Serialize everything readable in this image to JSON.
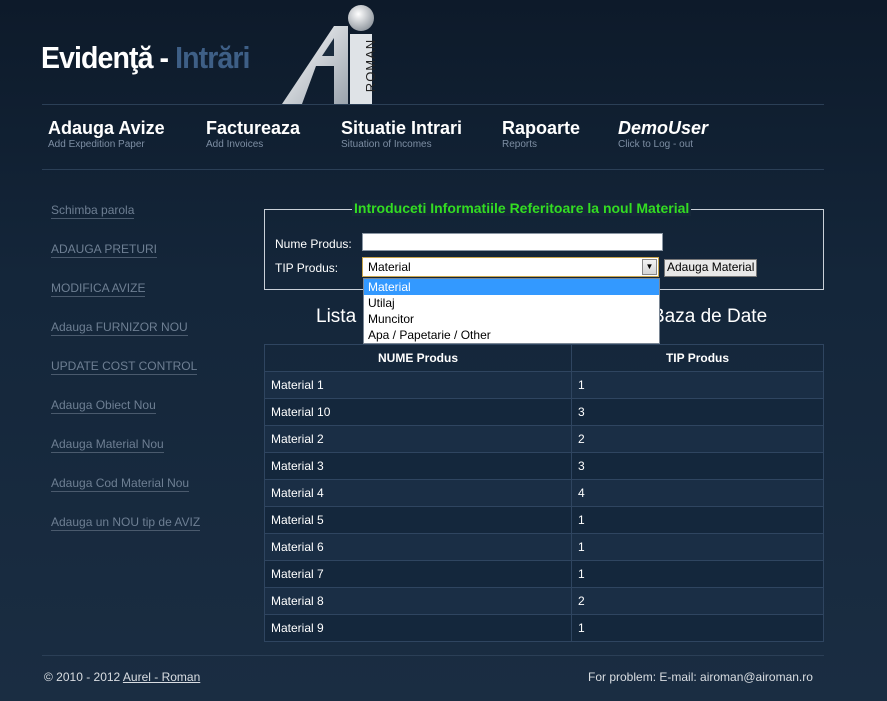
{
  "header": {
    "title_part1": "Evidenţă",
    "title_sep": " - ",
    "title_part2": "Intrări",
    "logo_text": "ROMAN"
  },
  "nav": [
    {
      "label": "Adauga Avize",
      "sub": "Add Expedition Paper"
    },
    {
      "label": "Factureaza",
      "sub": "Add Invoices"
    },
    {
      "label": "Situatie Intrari",
      "sub": "Situation of Incomes"
    },
    {
      "label": "Rapoarte",
      "sub": "Reports"
    },
    {
      "label": "DemoUser",
      "sub": "Click to Log - out"
    }
  ],
  "sidebar": [
    "Schimba parola",
    "ADAUGA PRETURI",
    "MODIFICA AVIZE",
    "Adauga FURNIZOR NOU",
    "UPDATE COST CONTROL",
    "Adauga Obiect Nou",
    "Adauga Material Nou",
    "Adauga Cod Material Nou",
    "Adauga un NOU tip de AVIZ"
  ],
  "form": {
    "legend": "Introduceti Informatiile Referitoare la noul Material",
    "name_label": "Nume Produs:",
    "name_value": "",
    "type_label": "TIP Produs:",
    "type_value": "Material",
    "submit_label": "Adauga Material",
    "options": [
      "Material",
      "Utilaj",
      "Muncitor",
      "Apa / Papetarie / Other"
    ]
  },
  "list": {
    "title_left": "Lista",
    "title_right": "Baza de Date",
    "columns": [
      "NUME Produs",
      "TIP Produs"
    ],
    "rows": [
      [
        "Material 1",
        "1"
      ],
      [
        "Material 10",
        "3"
      ],
      [
        "Material 2",
        "2"
      ],
      [
        "Material 3",
        "3"
      ],
      [
        "Material 4",
        "4"
      ],
      [
        "Material 5",
        "1"
      ],
      [
        "Material 6",
        "1"
      ],
      [
        "Material 7",
        "1"
      ],
      [
        "Material 8",
        "2"
      ],
      [
        "Material 9",
        "1"
      ]
    ]
  },
  "footer": {
    "copyright": "© 2010 - 2012",
    "author": "Aurel - Roman",
    "contact": "For problem: E-mail: airoman@airoman.ro"
  },
  "colors": {
    "legend_green": "#33dd22",
    "title_blue": "#3e5f86",
    "selected_option": "#3399ff"
  }
}
